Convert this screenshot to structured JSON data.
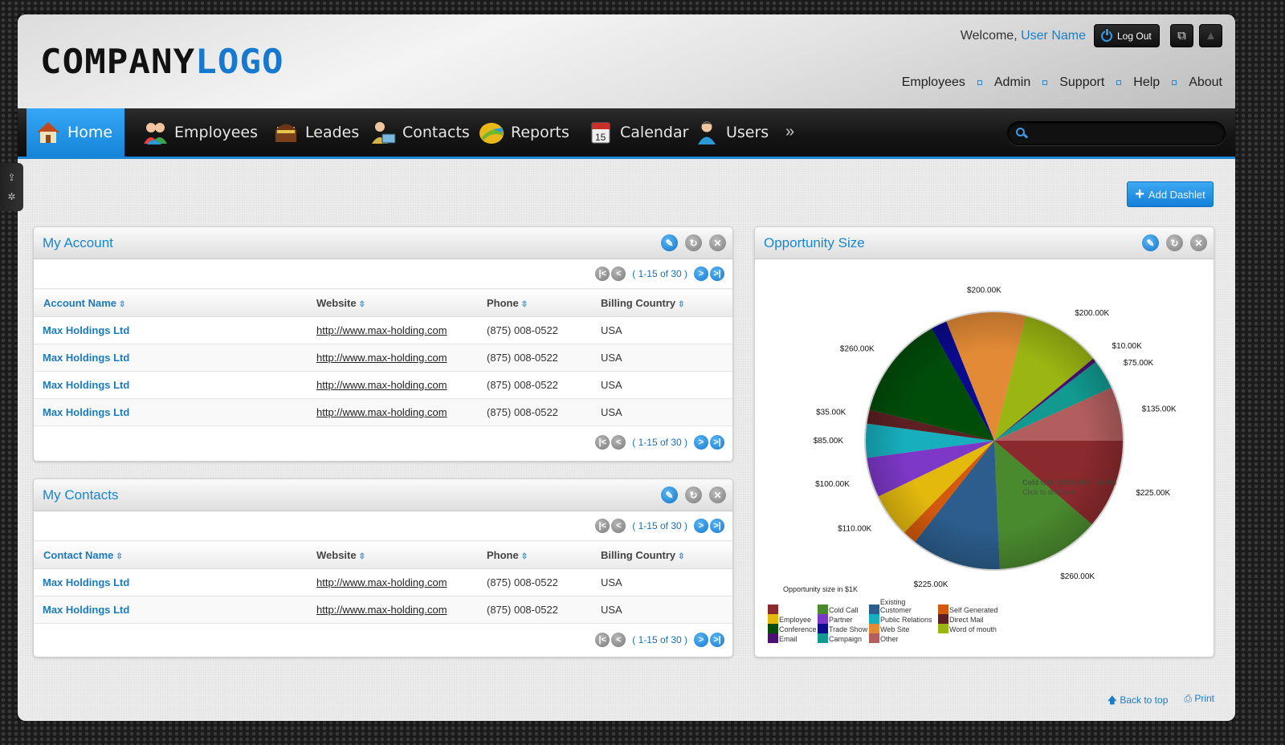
{
  "header": {
    "logo_part1": "COMPANY",
    "logo_part2": "LOGO",
    "welcome_prefix": "Welcome, ",
    "user_name": "User Name",
    "logout_label": "Log Out",
    "top_links": [
      "Employees",
      "Admin",
      "Support",
      "Help",
      "About"
    ]
  },
  "nav": {
    "items": [
      {
        "label": "Home",
        "icon": "home-icon",
        "active": true
      },
      {
        "label": "Employees",
        "icon": "employees-icon"
      },
      {
        "label": "Leades",
        "icon": "treasure-chest-icon"
      },
      {
        "label": "Contacts",
        "icon": "contact-card-icon"
      },
      {
        "label": "Reports",
        "icon": "reports-icon"
      },
      {
        "label": "Calendar",
        "icon": "calendar-icon"
      },
      {
        "label": "Users",
        "icon": "user-icon"
      }
    ],
    "more": "»",
    "search_placeholder": ""
  },
  "toolbar": {
    "add_dashlet_label": "Add Dashlet"
  },
  "my_account": {
    "title": "My Account",
    "pager_text": "( 1-15 of 30 )",
    "columns": [
      "Account Name",
      "Website",
      "Phone",
      "Billing Country"
    ],
    "rows": [
      [
        "Max Holdings Ltd",
        "http://www.max-holding.com",
        "(875) 008-0522",
        "USA"
      ],
      [
        "Max Holdings Ltd",
        "http://www.max-holding.com",
        "(875) 008-0522",
        "USA"
      ],
      [
        "Max Holdings Ltd",
        "http://www.max-holding.com",
        "(875) 008-0522",
        "USA"
      ],
      [
        "Max Holdings Ltd",
        "http://www.max-holding.com",
        "(875) 008-0522",
        "USA"
      ]
    ]
  },
  "my_contacts": {
    "title": "My Contacts",
    "pager_text": "( 1-15 of 30 )",
    "columns": [
      "Contact Name",
      "Website",
      "Phone",
      "Billing Country"
    ],
    "rows": [
      [
        "Max Holdings Ltd",
        "http://www.max-holding.com",
        "(875) 008-0522",
        "USA"
      ],
      [
        "Max Holdings Ltd",
        "http://www.max-holding.com",
        "(875) 008-0522",
        "USA"
      ]
    ]
  },
  "opportunity": {
    "title": "Opportunity Size",
    "tooltip_line1": "Cold Call: $260.00K - 16.6%",
    "tooltip_line2": "Click to drilldown"
  },
  "chart_data": {
    "type": "pie",
    "title": "Opportunity Size",
    "subtitle": "Opportunity size in $1K",
    "start": "3 o'clock, clockwise",
    "slices": [
      {
        "name": "",
        "value": 225,
        "label": "$225.00K",
        "color": "#8b2a2e"
      },
      {
        "name": "Cold Call",
        "value": 260,
        "label": "$260.00K",
        "color": "#4a8a2e"
      },
      {
        "name": "Existing Customer",
        "value": 225,
        "label": "$225.00K",
        "color": "#2c5d8c"
      },
      {
        "name": "Self Generated",
        "value": 35,
        "label": "",
        "color": "#d35a0c"
      },
      {
        "name": "Employee",
        "value": 110,
        "label": "$110.00K",
        "color": "#e3b90e"
      },
      {
        "name": "Partner",
        "value": 100,
        "label": "$100.00K",
        "color": "#7d38c8"
      },
      {
        "name": "Public Relations",
        "value": 85,
        "label": "$85.00K",
        "color": "#17aebd"
      },
      {
        "name": "Direct Mail",
        "value": 35,
        "label": "$35.00K",
        "color": "#5c2022"
      },
      {
        "name": "Conference",
        "value": 260,
        "label": "$260.00K",
        "color": "#004d0a"
      },
      {
        "name": "Trade Show",
        "value": 40,
        "label": "",
        "color": "#0a0a8c"
      },
      {
        "name": "Web Site",
        "value": 200,
        "label": "$200.00K",
        "color": "#e28a35"
      },
      {
        "name": "Word of mouth",
        "value": 200,
        "label": "$200.00K",
        "color": "#9bb512"
      },
      {
        "name": "Email",
        "value": 10,
        "label": "$10.00K",
        "color": "#4b1170"
      },
      {
        "name": "Campaign",
        "value": 75,
        "label": "$75.00K",
        "color": "#129a90"
      },
      {
        "name": "Other",
        "value": 135,
        "label": "$135.00K",
        "color": "#b35e5e"
      }
    ],
    "legend": [
      {
        "name": "",
        "color": "#8b2a2e"
      },
      {
        "name": "Employee",
        "color": "#e3b90e"
      },
      {
        "name": "Conference",
        "color": "#004d0a"
      },
      {
        "name": "Email",
        "color": "#4b1170"
      },
      {
        "name": "Cold Call",
        "color": "#4a8a2e"
      },
      {
        "name": "Partner",
        "color": "#7d38c8"
      },
      {
        "name": "Trade Show",
        "color": "#0a0a8c"
      },
      {
        "name": "Campaign",
        "color": "#129a90"
      },
      {
        "name": "Existing Customer",
        "color": "#2c5d8c"
      },
      {
        "name": "Public Relations",
        "color": "#17aebd"
      },
      {
        "name": "Web Site",
        "color": "#e28a35"
      },
      {
        "name": "Other",
        "color": "#b35e5e"
      },
      {
        "name": "Self Generated",
        "color": "#d35a0c"
      },
      {
        "name": "Direct Mail",
        "color": "#5c2022"
      },
      {
        "name": "Word of mouth",
        "color": "#9bb512"
      }
    ],
    "legend_position": "bottom-left"
  },
  "footer": {
    "back_to_top": "Back to top",
    "print": "Print"
  }
}
